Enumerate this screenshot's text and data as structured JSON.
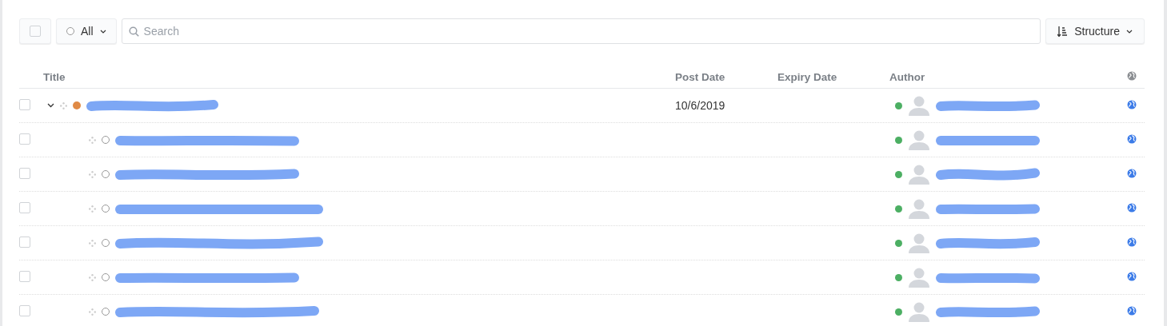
{
  "toolbar": {
    "select_all": {
      "checked": false
    },
    "status_filter": {
      "label": "All"
    },
    "search": {
      "placeholder": "Search"
    },
    "sort": {
      "label": "Structure"
    }
  },
  "table": {
    "columns": [
      "Title",
      "Post Date",
      "Expiry Date",
      "Author"
    ],
    "rows": [
      {
        "checked": false,
        "expanded": true,
        "color": "#e08a45",
        "post_date": "10/6/2019",
        "author_online": true,
        "children": [
          {
            "checked": false,
            "author_online": true
          },
          {
            "checked": false,
            "author_online": true
          },
          {
            "checked": false,
            "author_online": true
          },
          {
            "checked": false,
            "author_online": true
          },
          {
            "checked": false,
            "author_online": true
          },
          {
            "checked": false,
            "author_online": true
          }
        ]
      }
    ]
  }
}
